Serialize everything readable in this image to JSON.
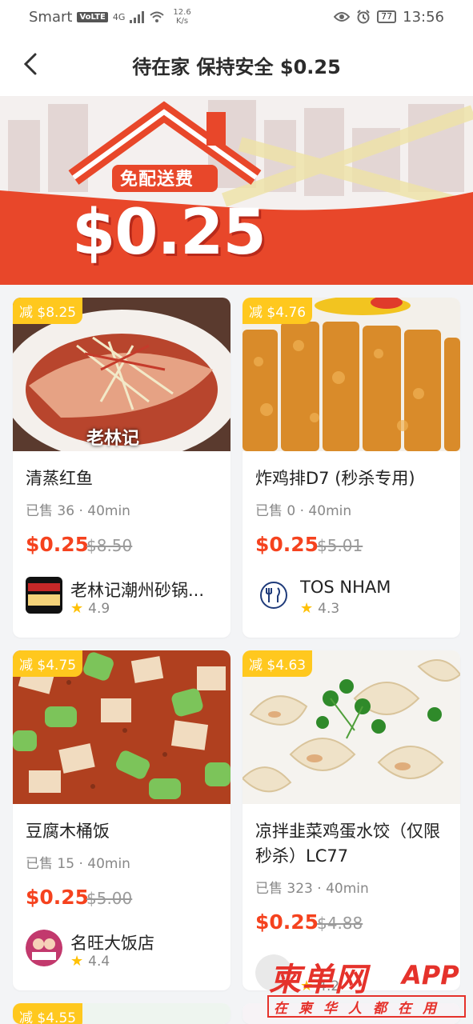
{
  "status_bar": {
    "carrier": "Smart",
    "volte": "VoLTE",
    "network": "4G",
    "speed_value": "12.6",
    "speed_unit": "K/s",
    "battery": "77",
    "time": "13:56"
  },
  "header": {
    "title": "待在家 保持安全 $0.25"
  },
  "banner": {
    "free_delivery_text": "免配送费",
    "price": "$0.25"
  },
  "products": [
    {
      "badge": "减 $8.25",
      "name": "清蒸红鱼",
      "sold": "已售 36 · 40min",
      "price": "$0.25",
      "original_price": "$8.50",
      "shop_name": "老林记潮州砂锅...",
      "rating": "4.9",
      "image_caption": "老林记"
    },
    {
      "badge": "减 $4.76",
      "name": "炸鸡排D7 (秒杀专用)",
      "sold": "已售 0 · 40min",
      "price": "$0.25",
      "original_price": "$5.01",
      "shop_name": "TOS NHAM",
      "rating": "4.3"
    },
    {
      "badge": "减 $4.75",
      "name": "豆腐木桶饭",
      "sold": "已售 15 · 40min",
      "price": "$0.25",
      "original_price": "$5.00",
      "shop_name": "名旺大饭店",
      "rating": "4.4"
    },
    {
      "badge": "减 $4.63",
      "name": "凉拌韭菜鸡蛋水饺（仅限秒杀）LC77",
      "sold": "已售 323 · 40min",
      "price": "$0.25",
      "original_price": "$4.88",
      "rating": "4.2"
    },
    {
      "badge": "减 $4.55"
    }
  ],
  "watermark": {
    "brand": "柬单网",
    "app": "APP",
    "slogan": "在柬华人都在用"
  },
  "colors": {
    "accent": "#f5421e",
    "badge": "#ffc81e",
    "banner_red": "#e8472a"
  }
}
